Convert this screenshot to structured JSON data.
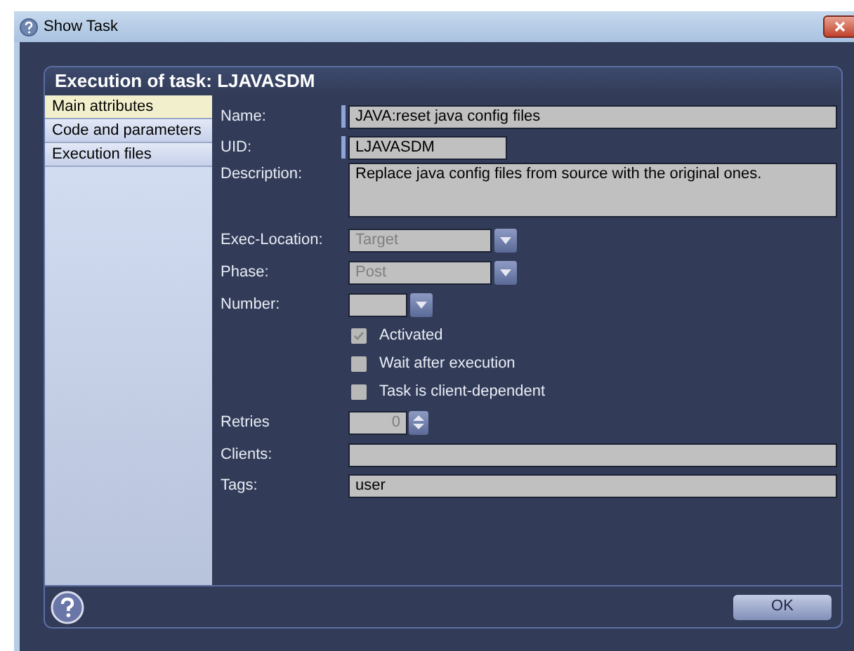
{
  "window": {
    "title": "Show Task"
  },
  "panel": {
    "title": "Execution of task: LJAVASDM"
  },
  "tabs": [
    {
      "label": "Main attributes",
      "selected": true
    },
    {
      "label": "Code and parameters",
      "selected": false
    },
    {
      "label": "Execution files",
      "selected": false
    }
  ],
  "fields": [
    {
      "kind": "text",
      "label": "Name:",
      "value": "JAVA:reset java config files",
      "marked": true
    },
    {
      "kind": "text",
      "label": "UID:",
      "value": "LJAVASDM",
      "marked": true
    },
    {
      "kind": "textarea",
      "label": "Description:",
      "value": "Replace java config files from source with the original ones."
    },
    {
      "kind": "dropdown",
      "label": "Exec-Location:",
      "value": "Target",
      "disabled": true
    },
    {
      "kind": "dropdown",
      "label": "Phase:",
      "value": "Post",
      "disabled": true
    },
    {
      "kind": "dropdown",
      "label": "Number:",
      "disabled": true
    },
    {
      "kind": "checkbox",
      "label": "Activated",
      "checked": true
    },
    {
      "kind": "checkbox",
      "label": "Wait after execution",
      "checked": false
    },
    {
      "kind": "checkbox",
      "label": "Task is client-dependent",
      "checked": false
    },
    {
      "kind": "spinner",
      "label": "Retries",
      "value": "0",
      "disabled": true
    },
    {
      "kind": "text",
      "label": "Clients:",
      "marked": false
    },
    {
      "kind": "text",
      "label": "Tags:",
      "value": "user",
      "marked": false
    }
  ],
  "buttons": [
    "OK"
  ]
}
